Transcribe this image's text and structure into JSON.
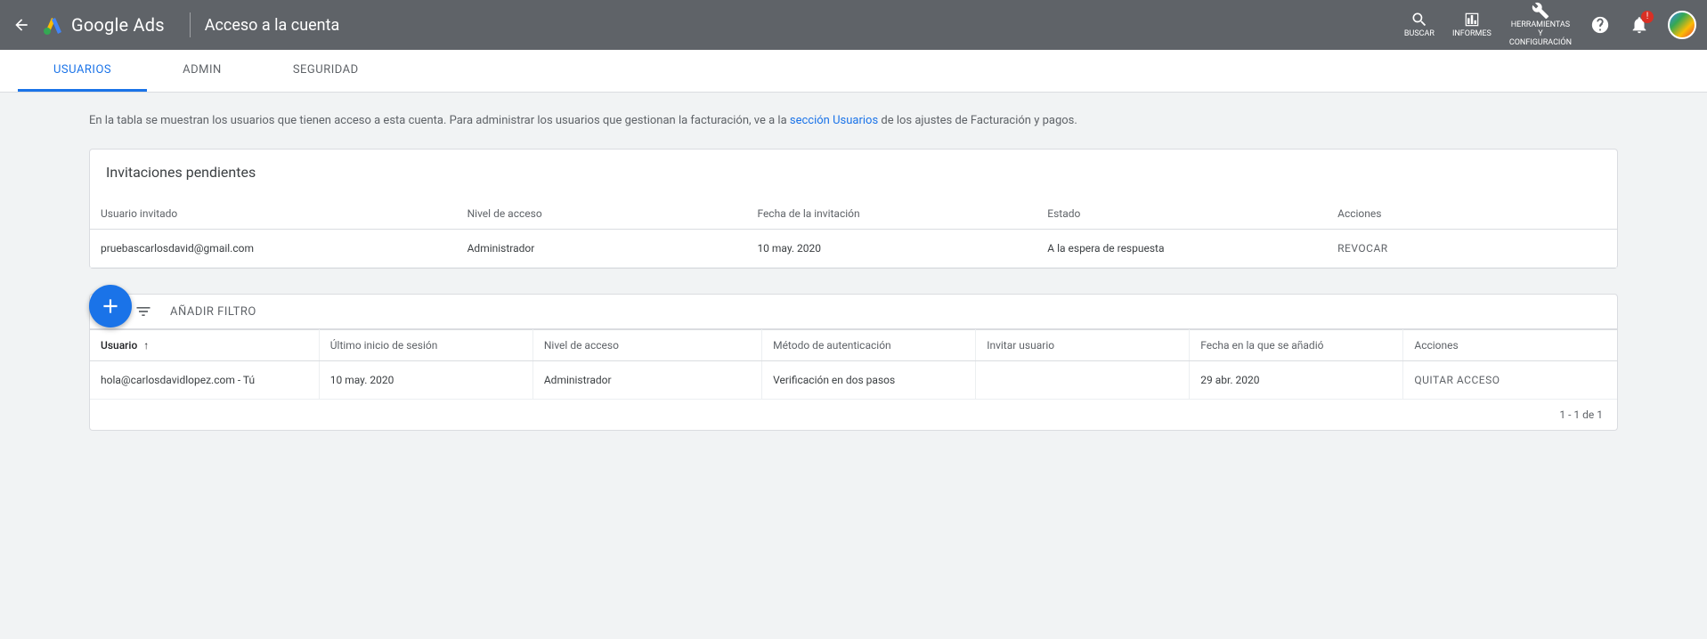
{
  "header": {
    "product_name": "Google Ads",
    "page_title": "Acceso a la cuenta",
    "actions": {
      "search_label": "BUSCAR",
      "reports_label": "INFORMES",
      "tools_label_1": "HERRAMIENTAS",
      "tools_label_2": "Y",
      "tools_label_3": "CONFIGURACIÓN"
    }
  },
  "tabs": {
    "users": "USUARIOS",
    "admin": "ADMIN",
    "security": "SEGURIDAD"
  },
  "intro": {
    "text_before": "En la tabla se muestran los usuarios que tienen acceso a esta cuenta. Para administrar los usuarios que gestionan la facturación, ve a la ",
    "link_text": "sección Usuarios",
    "text_after": " de los ajustes de Facturación y pagos."
  },
  "pending_card": {
    "title": "Invitaciones pendientes",
    "cols": {
      "user": "Usuario invitado",
      "level": "Nivel de acceso",
      "date": "Fecha de la invitación",
      "state": "Estado",
      "actions": "Acciones"
    },
    "row": {
      "user": "pruebascarlosdavid@gmail.com",
      "level": "Administrador",
      "date": "10 may. 2020",
      "state": "A la espera de respuesta",
      "action": "REVOCAR"
    }
  },
  "filter": {
    "add_filter": "AÑADIR FILTRO"
  },
  "users_table": {
    "cols": {
      "user": "Usuario",
      "last_login": "Último inicio de sesión",
      "level": "Nivel de acceso",
      "auth": "Método de autenticación",
      "invite": "Invitar usuario",
      "added": "Fecha en la que se añadió",
      "actions": "Acciones"
    },
    "row": {
      "user": "hola@carlosdavidlopez.com - Tú",
      "last_login": "10 may. 2020",
      "level": "Administrador",
      "auth": "Verificación en dos pasos",
      "invite": "",
      "added": "29 abr. 2020",
      "action": "QUITAR ACCESO"
    },
    "footer": "1 - 1 de 1"
  }
}
